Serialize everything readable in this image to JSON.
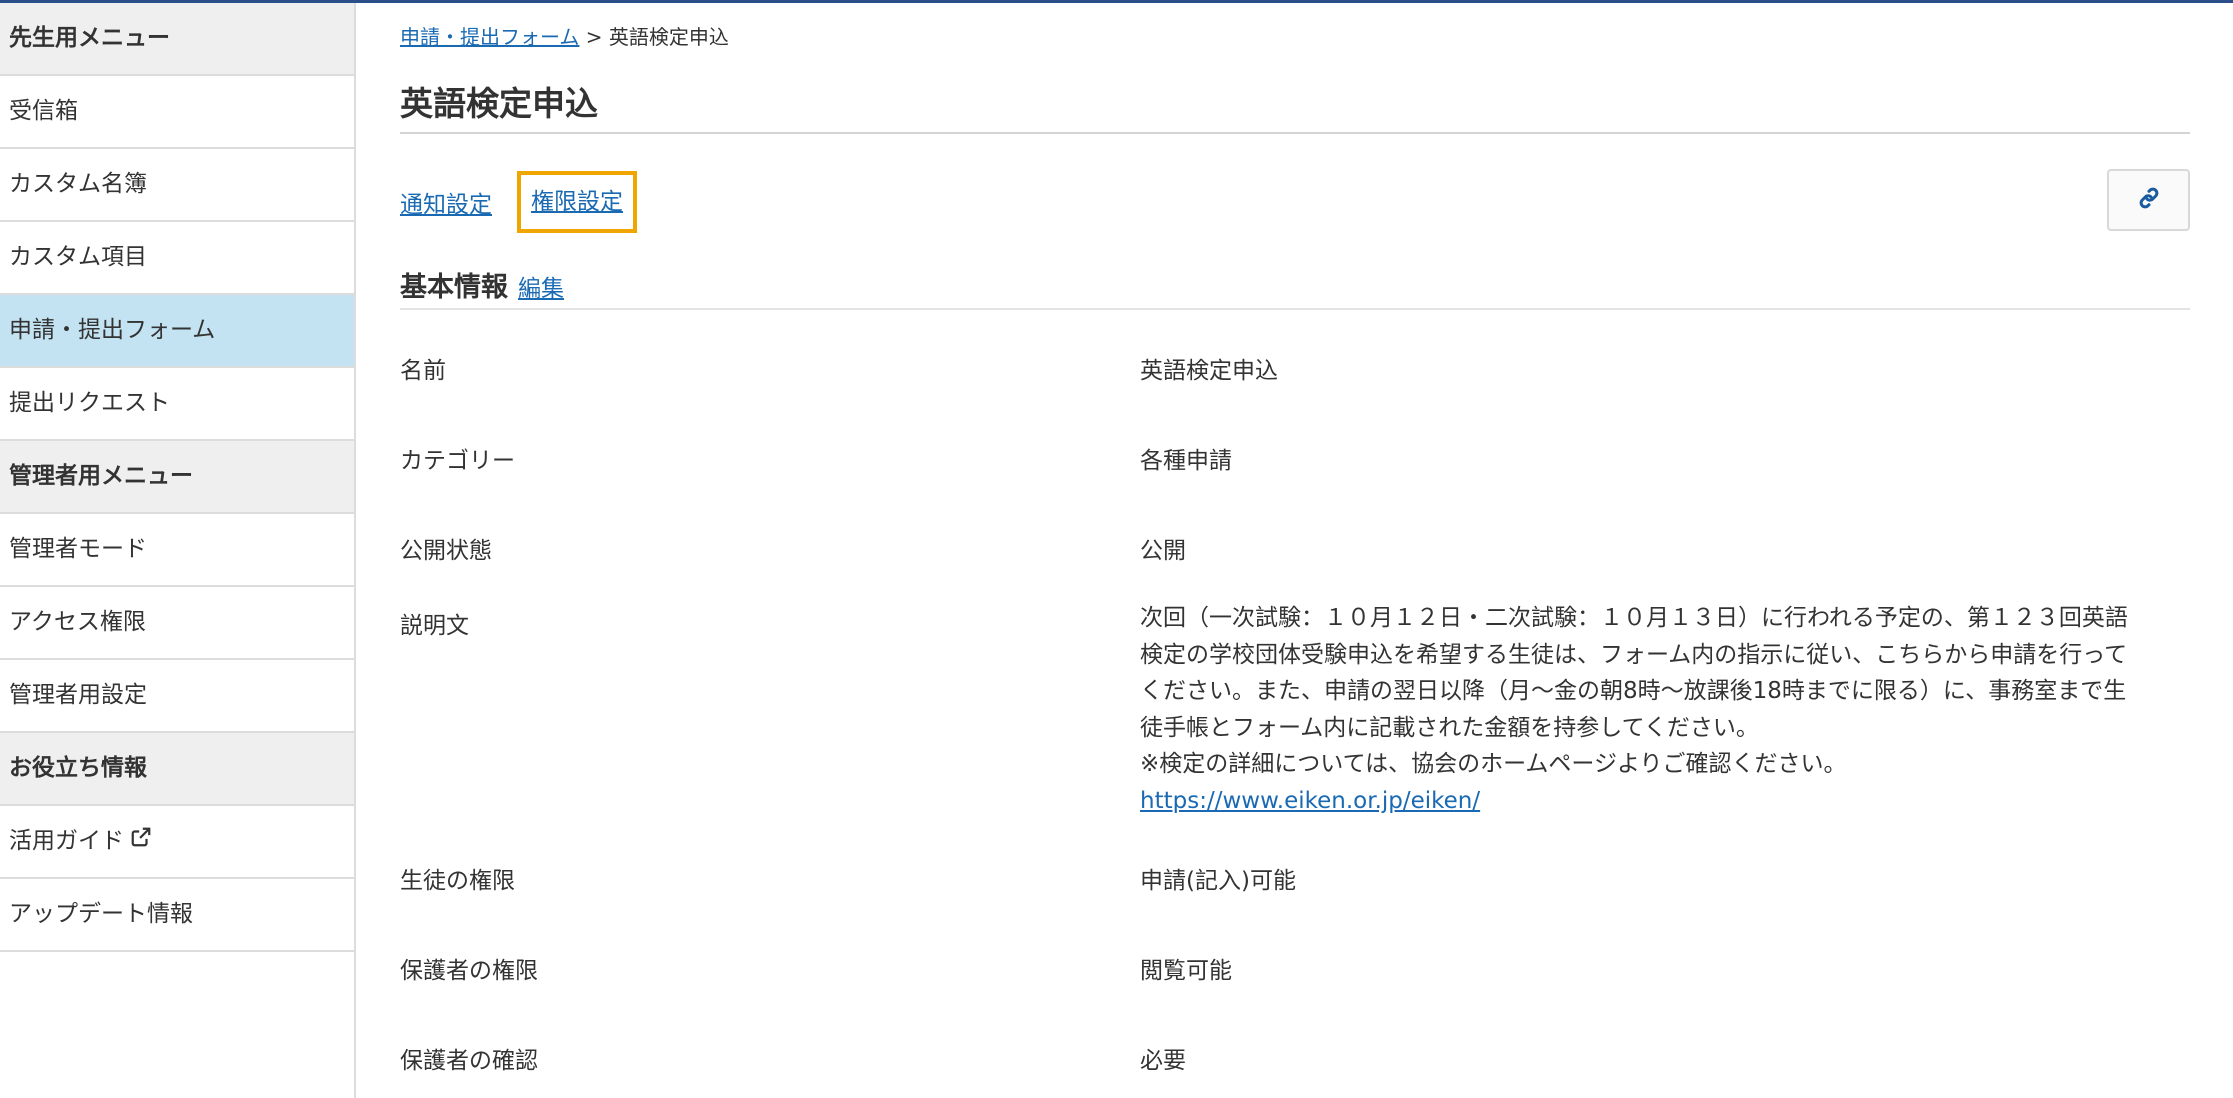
{
  "sidebar": {
    "teacher_header": "先生用メニュー",
    "teacher_items": [
      {
        "label": "受信箱"
      },
      {
        "label": "カスタム名簿"
      },
      {
        "label": "カスタム項目"
      },
      {
        "label": "申請・提出フォーム",
        "active": true
      },
      {
        "label": "提出リクエスト"
      }
    ],
    "admin_header": "管理者用メニュー",
    "admin_items": [
      {
        "label": "管理者モード"
      },
      {
        "label": "アクセス権限"
      },
      {
        "label": "管理者用設定"
      }
    ],
    "info_header": "お役立ち情報",
    "info_items": [
      {
        "label": "活用ガイド",
        "icon": "external-link-icon"
      },
      {
        "label": "アップデート情報"
      }
    ]
  },
  "breadcrumb": {
    "parent": "申請・提出フォーム",
    "separator": ">",
    "current": "英語検定申込"
  },
  "page": {
    "title": "英語検定申込",
    "links": {
      "notify": "通知設定",
      "permission": "権限設定"
    },
    "share_icon": "link-icon"
  },
  "basic_info": {
    "title": "基本情報",
    "edit": "編集",
    "rows": [
      {
        "label": "名前",
        "value": "英語検定申込"
      },
      {
        "label": "カテゴリー",
        "value": "各種申請"
      },
      {
        "label": "公開状態",
        "value": "公開"
      },
      {
        "label": "説明文",
        "lines": [
          "次回（一次試験：１０月１２日・二次試験：１０月１３日）に行われる予定の、第１２３回英語",
          "検定の学校団体受験申込を希望する生徒は、フォーム内の指示に従い、こちらから申請を行って",
          "ください。また、申請の翌日以降（月〜金の朝8時〜放課後18時までに限る）に、事務室まで生",
          "徒手帳とフォーム内に記載された金額を持参してください。",
          "※検定の詳細については、協会のホームページよりご確認ください。"
        ],
        "link": "https://www.eiken.or.jp/eiken/"
      },
      {
        "label": "生徒の権限",
        "value": "申請(記入)可能"
      },
      {
        "label": "保護者の権限",
        "value": "閲覧可能"
      },
      {
        "label": "保護者の確認",
        "value": "必要"
      }
    ]
  },
  "colors": {
    "link": "#1a6ab3",
    "active_sidebar": "#c3e3f2",
    "highlight_border": "#f0a500",
    "top_bar": "#2b4f8a"
  }
}
